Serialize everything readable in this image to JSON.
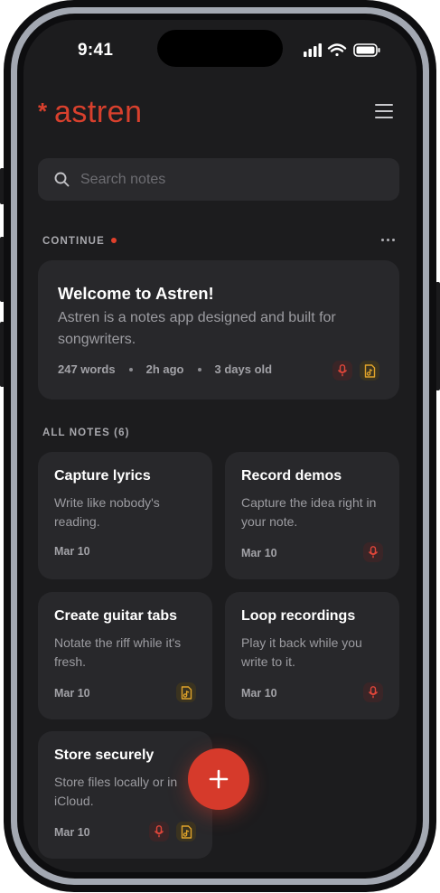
{
  "status_bar": {
    "time": "9:41"
  },
  "header": {
    "logo_text": "astren",
    "logo_mark": "*"
  },
  "search": {
    "placeholder": "Search notes"
  },
  "continue": {
    "label": "CONTINUE",
    "card": {
      "title": "Welcome to Astren!",
      "description": "Astren is a notes app designed and built for songwriters.",
      "words": "247 words",
      "edited": "2h ago",
      "age": "3 days old",
      "tags": [
        "mic-icon",
        "file-music-icon"
      ]
    }
  },
  "all_notes": {
    "label": "ALL NOTES (6)",
    "notes": [
      {
        "title": "Capture lyrics",
        "description": "Write like nobody's reading.",
        "date": "Mar 10",
        "tags": []
      },
      {
        "title": "Record demos",
        "description": "Capture the idea right in your note.",
        "date": "Mar 10",
        "tags": [
          "mic-icon"
        ]
      },
      {
        "title": "Create guitar tabs",
        "description": "Notate the riff while it's fresh.",
        "date": "Mar 10",
        "tags": [
          "file-music-icon"
        ]
      },
      {
        "title": "Loop recordings",
        "description": "Play it back while you write to it.",
        "date": "Mar 10",
        "tags": [
          "mic-icon"
        ]
      },
      {
        "title": "Store securely",
        "description": "Store files locally or in iCloud.",
        "date": "Mar 10",
        "tags": [
          "mic-icon",
          "file-music-icon"
        ]
      }
    ]
  },
  "fab": {
    "icon": "plus-icon"
  },
  "colors": {
    "accent": "#d63a2b",
    "background": "#1c1c1e",
    "card": "#28282b",
    "mic_tag": "#e0463a",
    "file_tag": "#e0a32a"
  }
}
